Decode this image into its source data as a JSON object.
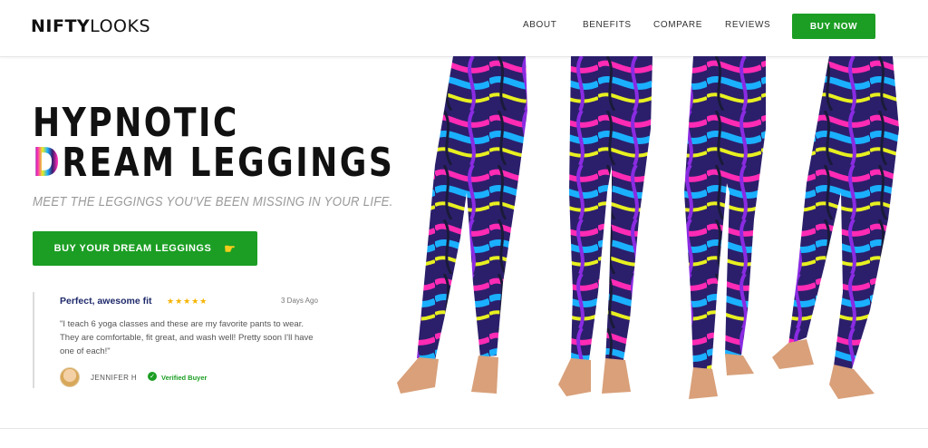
{
  "header": {
    "logo_bold": "NIFTY",
    "logo_light": "LOOKS",
    "nav": [
      "ABOUT",
      "BENEFITS",
      "COMPARE",
      "REVIEWS"
    ],
    "buy_now": "BUY NOW"
  },
  "hero": {
    "title_line1": "HYPNOTIC",
    "title_line2_first": "D",
    "title_line2_rest": "REAM LEGGINGS",
    "subtitle": "MEET THE LEGGINGS YOU'VE BEEN MISSING IN YOUR LIFE.",
    "cta_label": "BUY YOUR DREAM LEGGINGS",
    "cta_icon": "pointing-hand-icon"
  },
  "review": {
    "title": "Perfect, awesome fit",
    "stars": "★★★★★",
    "rating": 5,
    "date": "3 Days Ago",
    "body": "\"I teach 6 yoga classes and these are my favorite pants to wear. They are comfortable, fit great, and wash well! Pretty soon I'll have one of each!\"",
    "name": "JENNIFER H",
    "verified": "Verified Buyer"
  },
  "colors": {
    "accent": "#1b9e23",
    "title": "#111111",
    "subtitle": "#9a9a9a",
    "review_title": "#1f2a6b",
    "stars": "#f5b400"
  }
}
